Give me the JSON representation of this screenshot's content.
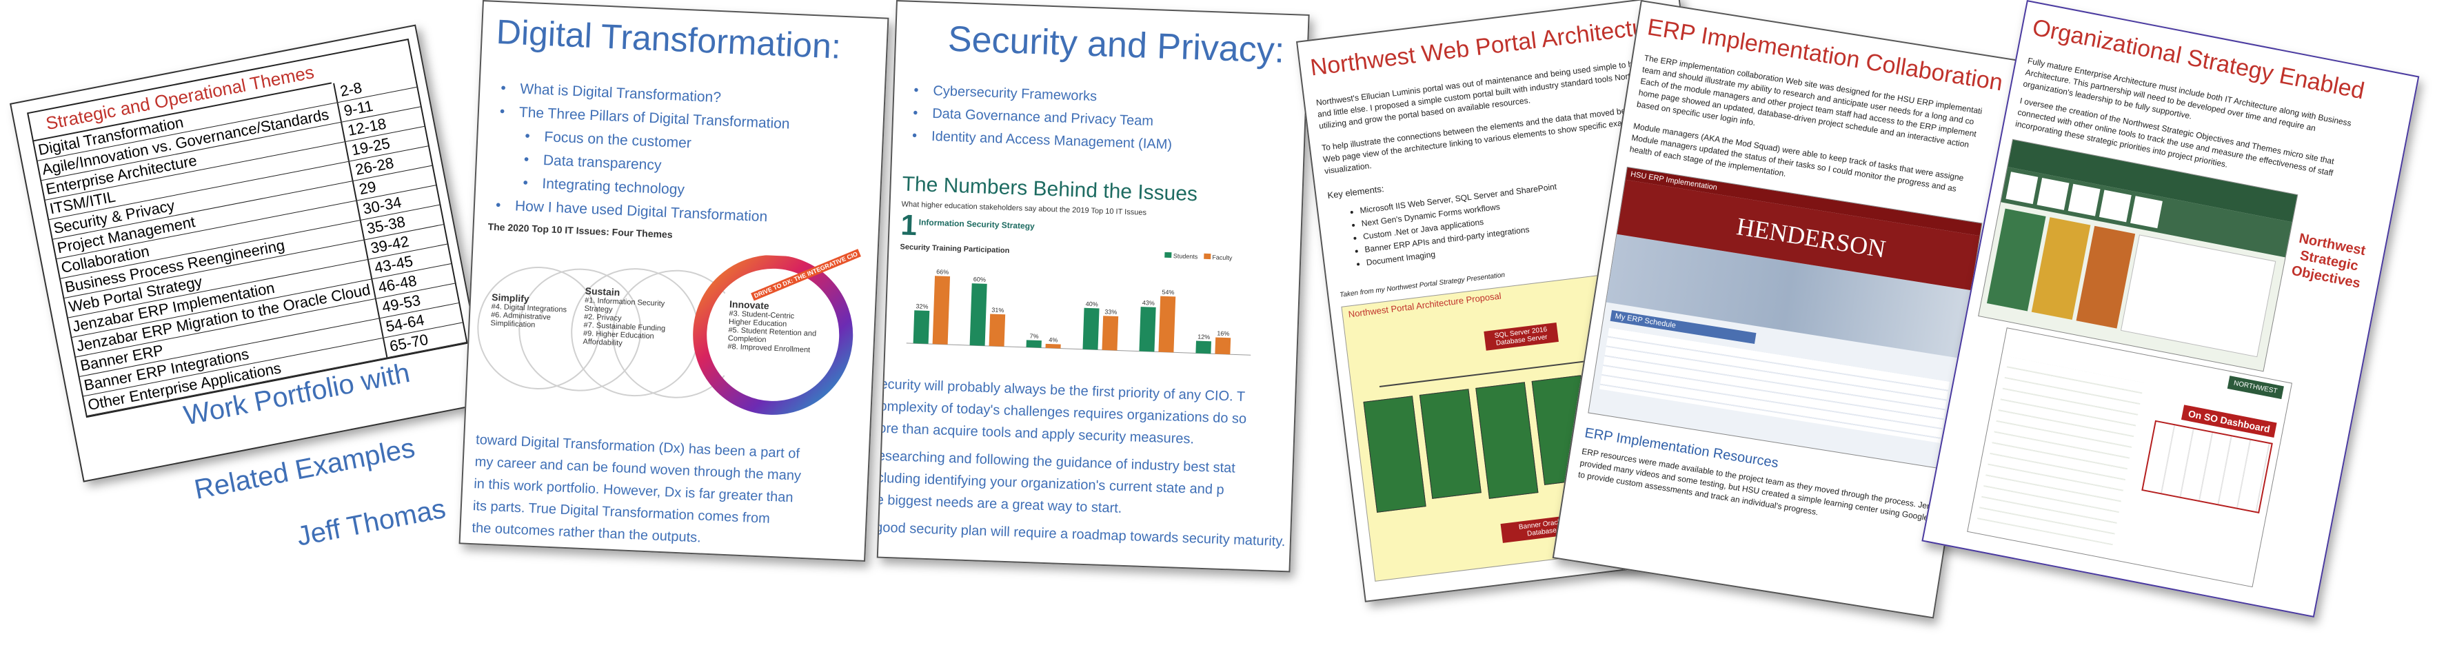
{
  "portfolio": {
    "toc_title": "Strategic and Operational Themes",
    "toc": [
      {
        "label": "Digital Transformation",
        "pages": "2-8"
      },
      {
        "label": "Agile/Innovation vs. Governance/Standards",
        "pages": "9-11"
      },
      {
        "label": "Enterprise Architecture",
        "pages": "12-18"
      },
      {
        "label": "ITSM/ITIL",
        "pages": "19-25"
      },
      {
        "label": "Security & Privacy",
        "pages": "26-28"
      },
      {
        "label": "Project Management",
        "pages": "29"
      },
      {
        "label": "Collaboration",
        "pages": "30-34"
      },
      {
        "label": "Business Process Reengineering",
        "pages": "35-38"
      },
      {
        "label": "Web Portal Strategy",
        "pages": "39-42"
      },
      {
        "label": "Jenzabar ERP Implementation",
        "pages": "43-45"
      },
      {
        "label": "Jenzabar ERP Migration to the Oracle Cloud",
        "pages": "46-48"
      },
      {
        "label": "Banner ERP",
        "pages": "49-53"
      },
      {
        "label": "Banner ERP Integrations",
        "pages": "54-64"
      },
      {
        "label": "Other Enterprise Applications",
        "pages": "65-70"
      }
    ],
    "title_line1": "Work Portfolio with",
    "title_line2": "Related Examples",
    "author": "Jeff Thomas"
  },
  "digital": {
    "title": "Digital Transformation:",
    "bullets": [
      "What is Digital Transformation?",
      "The Three Pillars of Digital Transformation"
    ],
    "sub_bullets": [
      "Focus on the customer",
      "Data transparency",
      "Integrating technology"
    ],
    "last_bullet": "How I have used Digital Transformation",
    "graphic_title": "The 2020 Top 10 IT Issues: Four Themes",
    "simplify": {
      "title": "Simplify",
      "items": [
        "#4. Digital Integrations",
        "#6. Administrative Simplification"
      ]
    },
    "sustain": {
      "title": "Sustain",
      "items": [
        "#1. Information Security Strategy",
        "#2. Privacy",
        "#7. Sustainable Funding",
        "#9. Higher Education Affordability"
      ]
    },
    "innovate": {
      "title": "Innovate",
      "items": [
        "#3. Student-Centric Higher Education",
        "#5. Student Retention and Completion",
        "#8. Improved Enrollment"
      ]
    },
    "ring_label": "DRIVE TO DX: THE INTEGRATIVE CIO",
    "body": [
      "toward Digital Transformation (Dx) has been a part of",
      "my career and can be found woven through the many",
      "in this work portfolio. However, Dx is far greater than",
      "its parts. True Digital Transformation comes from",
      "the outcomes rather than the outputs."
    ]
  },
  "security": {
    "title": "Security and Privacy:",
    "bullets": [
      "Cybersecurity Frameworks",
      "Data Governance and Privacy Team",
      "Identity and Access Management (IAM)"
    ],
    "numbers_title": "The Numbers Behind the Issues",
    "numbers_sub": "What higher education stakeholders say about the 2019 Top 10 IT Issues",
    "issue_num": "1",
    "issue_title": "Information Security Strategy",
    "issue_desc": "Security Training Participation",
    "legend": [
      "Students",
      "Faculty"
    ],
    "bars": [
      {
        "a": 32,
        "b": 66
      },
      {
        "a": 60,
        "b": 31
      },
      {
        "a": 7,
        "b": 4
      },
      {
        "a": 40,
        "b": 33
      },
      {
        "a": 43,
        "b": 54
      },
      {
        "a": 12,
        "b": 16
      }
    ],
    "bar_labels": [
      [
        "32%",
        "66%"
      ],
      [
        "60%",
        "31%"
      ],
      [
        "7%",
        "4%"
      ],
      [
        "40%",
        "33%"
      ],
      [
        "43%",
        "54%"
      ],
      [
        "12%",
        "16%"
      ]
    ],
    "body": [
      "ecurity will probably always be the first priority of any CIO. T",
      "omplexity of today's challenges requires organizations do so",
      "ore than acquire tools and apply security measures.",
      "esearching and following the guidance of industry best stat",
      "cluding identifying your organization's current state and p",
      "e biggest needs are a great way to start.",
      "good security plan will require a roadmap towards security maturity."
    ]
  },
  "nwportal": {
    "title": "Northwest Web Portal Architecture",
    "para1": [
      "Northwest's Ellucian Luminis portal was out of maintenance and being used simple to host",
      "and little else. I proposed a simple custom portal built with industry standard tools Northw",
      "utilizing and grow the portal based on available resources."
    ],
    "para2": [
      "To help illustrate the connections between the elements and the data that moved betwe",
      "Web page view of the architecture linking to various elements to show specific example",
      "visualization."
    ],
    "key_label": "Key elements:",
    "key_items": [
      "Microsoft IIS Web Server, SQL Server and SharePoint",
      "Next Gen's Dynamic Forms workflows",
      "Custom .Net or Java applications",
      "Banner ERP APIs and third-party integrations",
      "Document Imaging"
    ],
    "caption": "Taken from my Northwest Portal Strategy Presentation",
    "diagram_title": "Northwest Portal Architecture Proposal",
    "db_top": "SQL Server 2016 Database Server",
    "db_bottom": "Banner Oracle Database"
  },
  "erp": {
    "title": "ERP Implementation Collaboration",
    "para1": [
      "The ERP implementation collaboration Web site was designed for the HSU ERP implementati",
      "team and should illustrate my ability to research and anticipate user needs for a long and co",
      "Each of the module managers and other project team staff had access to the ERP implement",
      "home page showed an updated, database-driven project schedule and an interactive action",
      "based on specific user login info."
    ],
    "para2": [
      "Module managers (AKA the Mod Squad) were able to keep track of tasks that were assigne",
      "Module managers updated the status of their tasks so I could monitor the progress and as",
      "health of each stage of the implementation."
    ],
    "screenshot_bar": "HSU ERP Implementation",
    "brand": "HENDERSON",
    "schedule_label": "My ERP Schedule",
    "resources_title": "ERP Implementation Resources",
    "resources_body": [
      "ERP resources were made available to the project team as they moved through the process. Jenzabar",
      "provided many videos and some testing, but HSU created a simple learning center using Google Classroom",
      "to provide custom assessments and track an individual's progress."
    ]
  },
  "org": {
    "title": "Organizational Strategy Enabled",
    "para": [
      "Fully mature Enterprise Architecture must include both IT Architecture along with Business",
      "Architecture. This partnership will need to be developed over time and require an",
      "organization's leadership to be fully supportive.",
      "I oversee the creation of the Northwest Strategic Objectives and Themes micro site that",
      "connected with other online tools to track the use and measure the effectiveness of staff",
      "incorporating these strategic priorities into project priorities."
    ],
    "callout": [
      "Northwest",
      "Strategic",
      "Objectives"
    ],
    "dashboard_label": "On SO Dashboard",
    "brand": "NORTHWEST"
  }
}
